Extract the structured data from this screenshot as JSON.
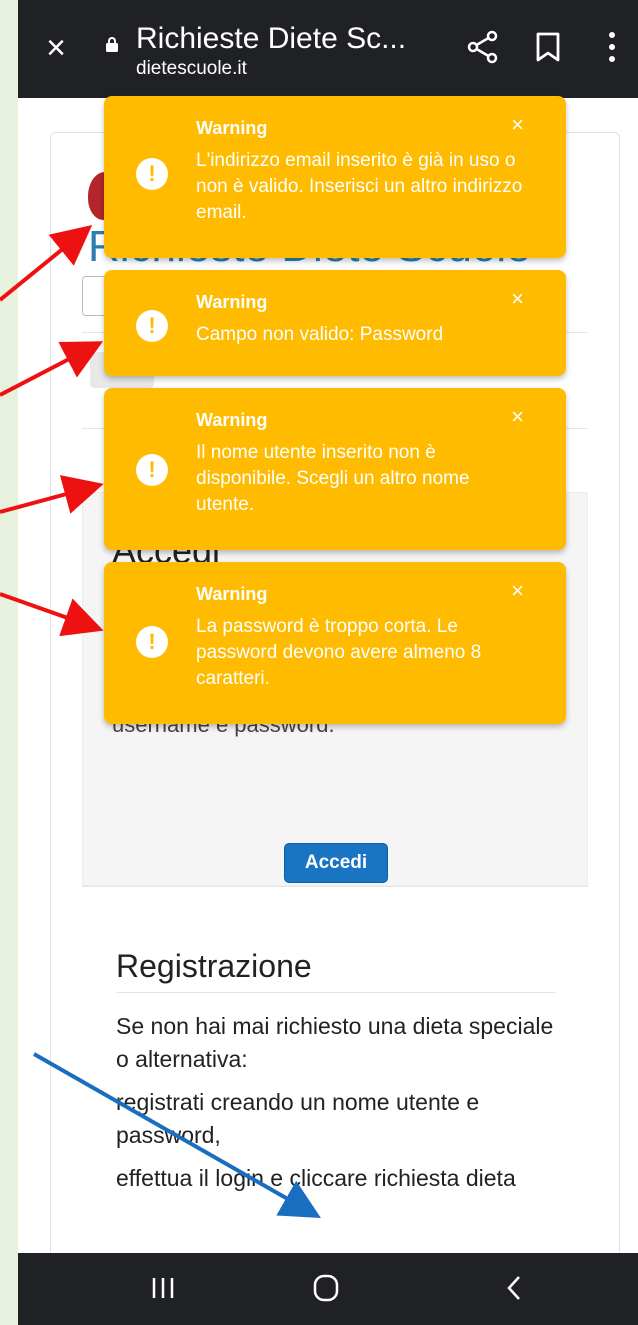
{
  "browser": {
    "title": "Richieste Diete Sc...",
    "url": "dietescuole.it",
    "icons": [
      "close-icon",
      "lock-icon",
      "share-icon",
      "bookmark-icon",
      "more-icon"
    ]
  },
  "page": {
    "site_heading": "Richieste Diete Scuole",
    "login": {
      "title": "Accedi",
      "description": "username e password.",
      "button_label": "Accedi"
    },
    "registration": {
      "title": "Registrazione",
      "line1": "Se non hai mai richiesto una dieta speciale o alternativa:",
      "line2": "registrati creando un nome utente e password,",
      "line3": "effettua il login e cliccare richiesta dieta"
    }
  },
  "toasts": [
    {
      "title": "Warning",
      "message": "L'indirizzo email inserito è già in uso o non è valido. Inserisci un altro indirizzo email.",
      "close": "×"
    },
    {
      "title": "Warning",
      "message": "Campo non valido: Password",
      "close": "×"
    },
    {
      "title": "Warning",
      "message": "Il nome utente inserito non è disponibile. Scegli un altro nome utente.",
      "close": "×"
    },
    {
      "title": "Warning",
      "message": "La password è troppo corta. Le password devono avere almeno 8 caratteri.",
      "close": "×"
    }
  ],
  "toast_icon_glyph": "!",
  "colors": {
    "toast_bg": "#ffbb00",
    "bar_bg": "#202124",
    "accent_blue": "#1a74c4",
    "arrow_red": "#ee1111",
    "arrow_blue": "#1a6ec0",
    "page_bg": "#e8f1de"
  },
  "navbar": {
    "icons": [
      "recents-icon",
      "home-icon",
      "back-icon"
    ]
  }
}
